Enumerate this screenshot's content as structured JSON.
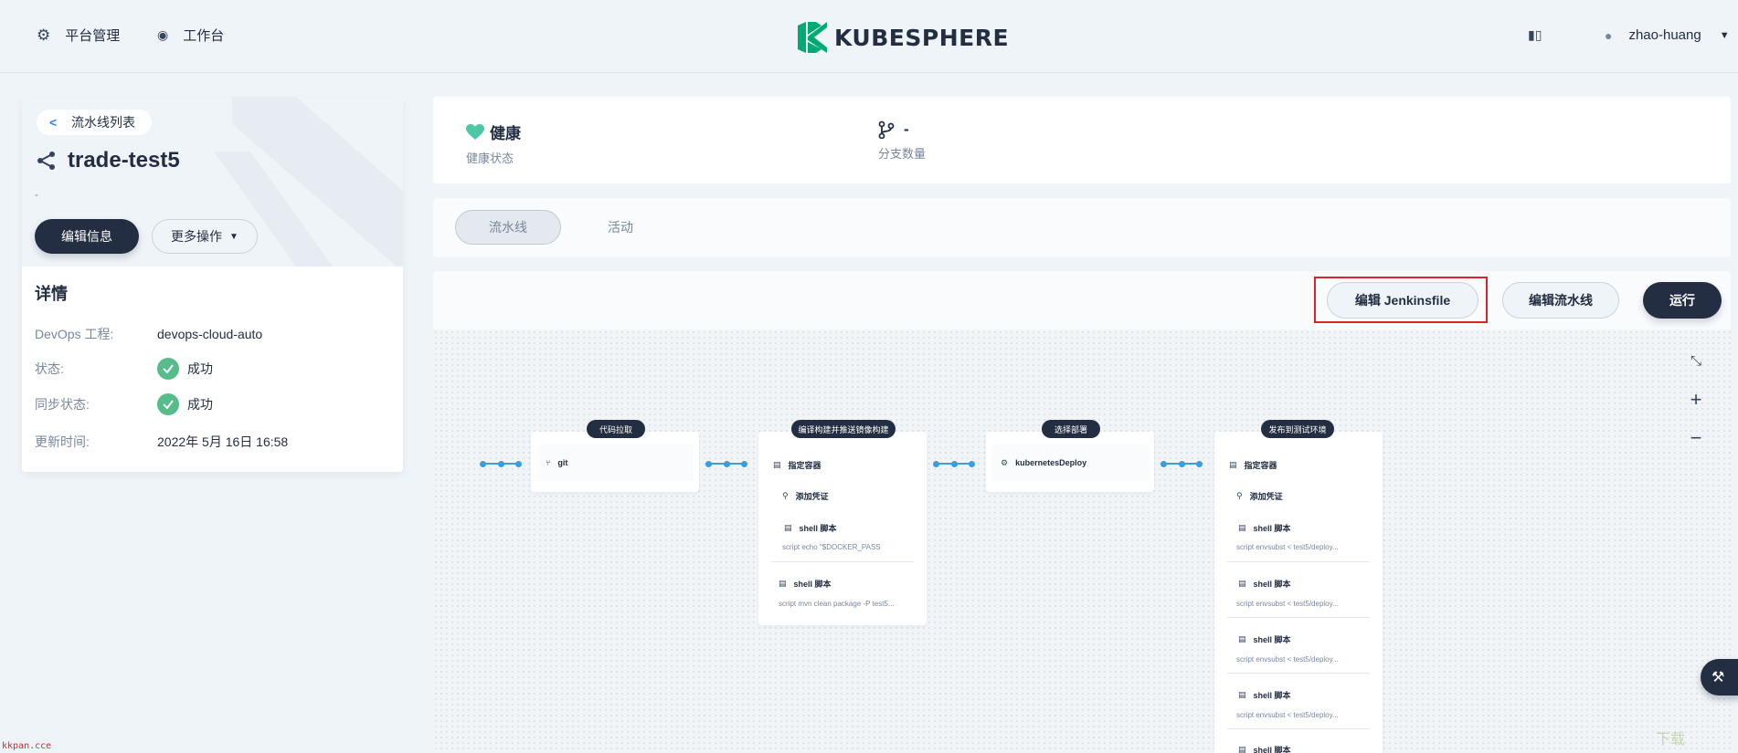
{
  "nav": {
    "platform": "平台管理",
    "workbench": "工作台",
    "logo": "KUBESPHERE",
    "user": "zhao-huang"
  },
  "left": {
    "back_label": "流水线列表",
    "pipeline_name": "trade-test5",
    "description": "-",
    "edit_info": "编辑信息",
    "more_actions": "更多操作",
    "detail_heading": "详情",
    "details": [
      {
        "label": "DevOps 工程:",
        "value": "devops-cloud-auto"
      },
      {
        "label": "状态:",
        "value": "成功"
      },
      {
        "label": "同步状态:",
        "value": "成功"
      },
      {
        "label": "更新时间:",
        "value": "2022年 5月 16日 16:58"
      }
    ]
  },
  "stats": {
    "health_value": "健康",
    "health_label": "健康状态",
    "branch_value": "-",
    "branch_label": "分支数量"
  },
  "tabs": [
    "流水线",
    "活动"
  ],
  "toolbar": {
    "edit_jenkinsfile": "编辑 Jenkinsfile",
    "edit_pipeline": "编辑流水线",
    "run": "运行"
  },
  "colors": {
    "accent_dark": "#242e42",
    "success": "#55bc8a",
    "connector": "#3b9ed8",
    "highlight": "#d8242c"
  },
  "stages": [
    {
      "label": "代码拉取",
      "steps": [
        {
          "icon": "git-icon",
          "name": "git"
        }
      ]
    },
    {
      "label": "编译构建并推送镜像构建",
      "steps": [
        {
          "icon": "container-icon",
          "name": "指定容器"
        },
        {
          "icon": "key-icon",
          "name": "添加凭证"
        },
        {
          "icon": "terminal-icon",
          "name": "shell 脚本",
          "script": "script   echo \"$DOCKER_PASS"
        },
        {
          "icon": "terminal-icon",
          "name": "shell 脚本",
          "script": "script   mvn clean package -P test5..."
        }
      ]
    },
    {
      "label": "选择部署",
      "steps": [
        {
          "icon": "k8s-icon",
          "name": "kubernetesDeploy"
        }
      ]
    },
    {
      "label": "发布到测试环境",
      "steps": [
        {
          "icon": "container-icon",
          "name": "指定容器"
        },
        {
          "icon": "key-icon",
          "name": "添加凭证"
        },
        {
          "icon": "terminal-icon",
          "name": "shell 脚本",
          "script": "script   envsubst < test5/deploy..."
        },
        {
          "icon": "terminal-icon",
          "name": "shell 脚本",
          "script": "script   envsubst < test5/deploy..."
        },
        {
          "icon": "terminal-icon",
          "name": "shell 脚本",
          "script": "script   envsubst < test5/deploy..."
        },
        {
          "icon": "terminal-icon",
          "name": "shell 脚本",
          "script": "script   envsubst < test5/deploy..."
        },
        {
          "icon": "terminal-icon",
          "name": "shell 脚本"
        }
      ]
    }
  ],
  "watermarks": {
    "bottom_left": "kkpan.cce",
    "bottom_right": "下载"
  }
}
